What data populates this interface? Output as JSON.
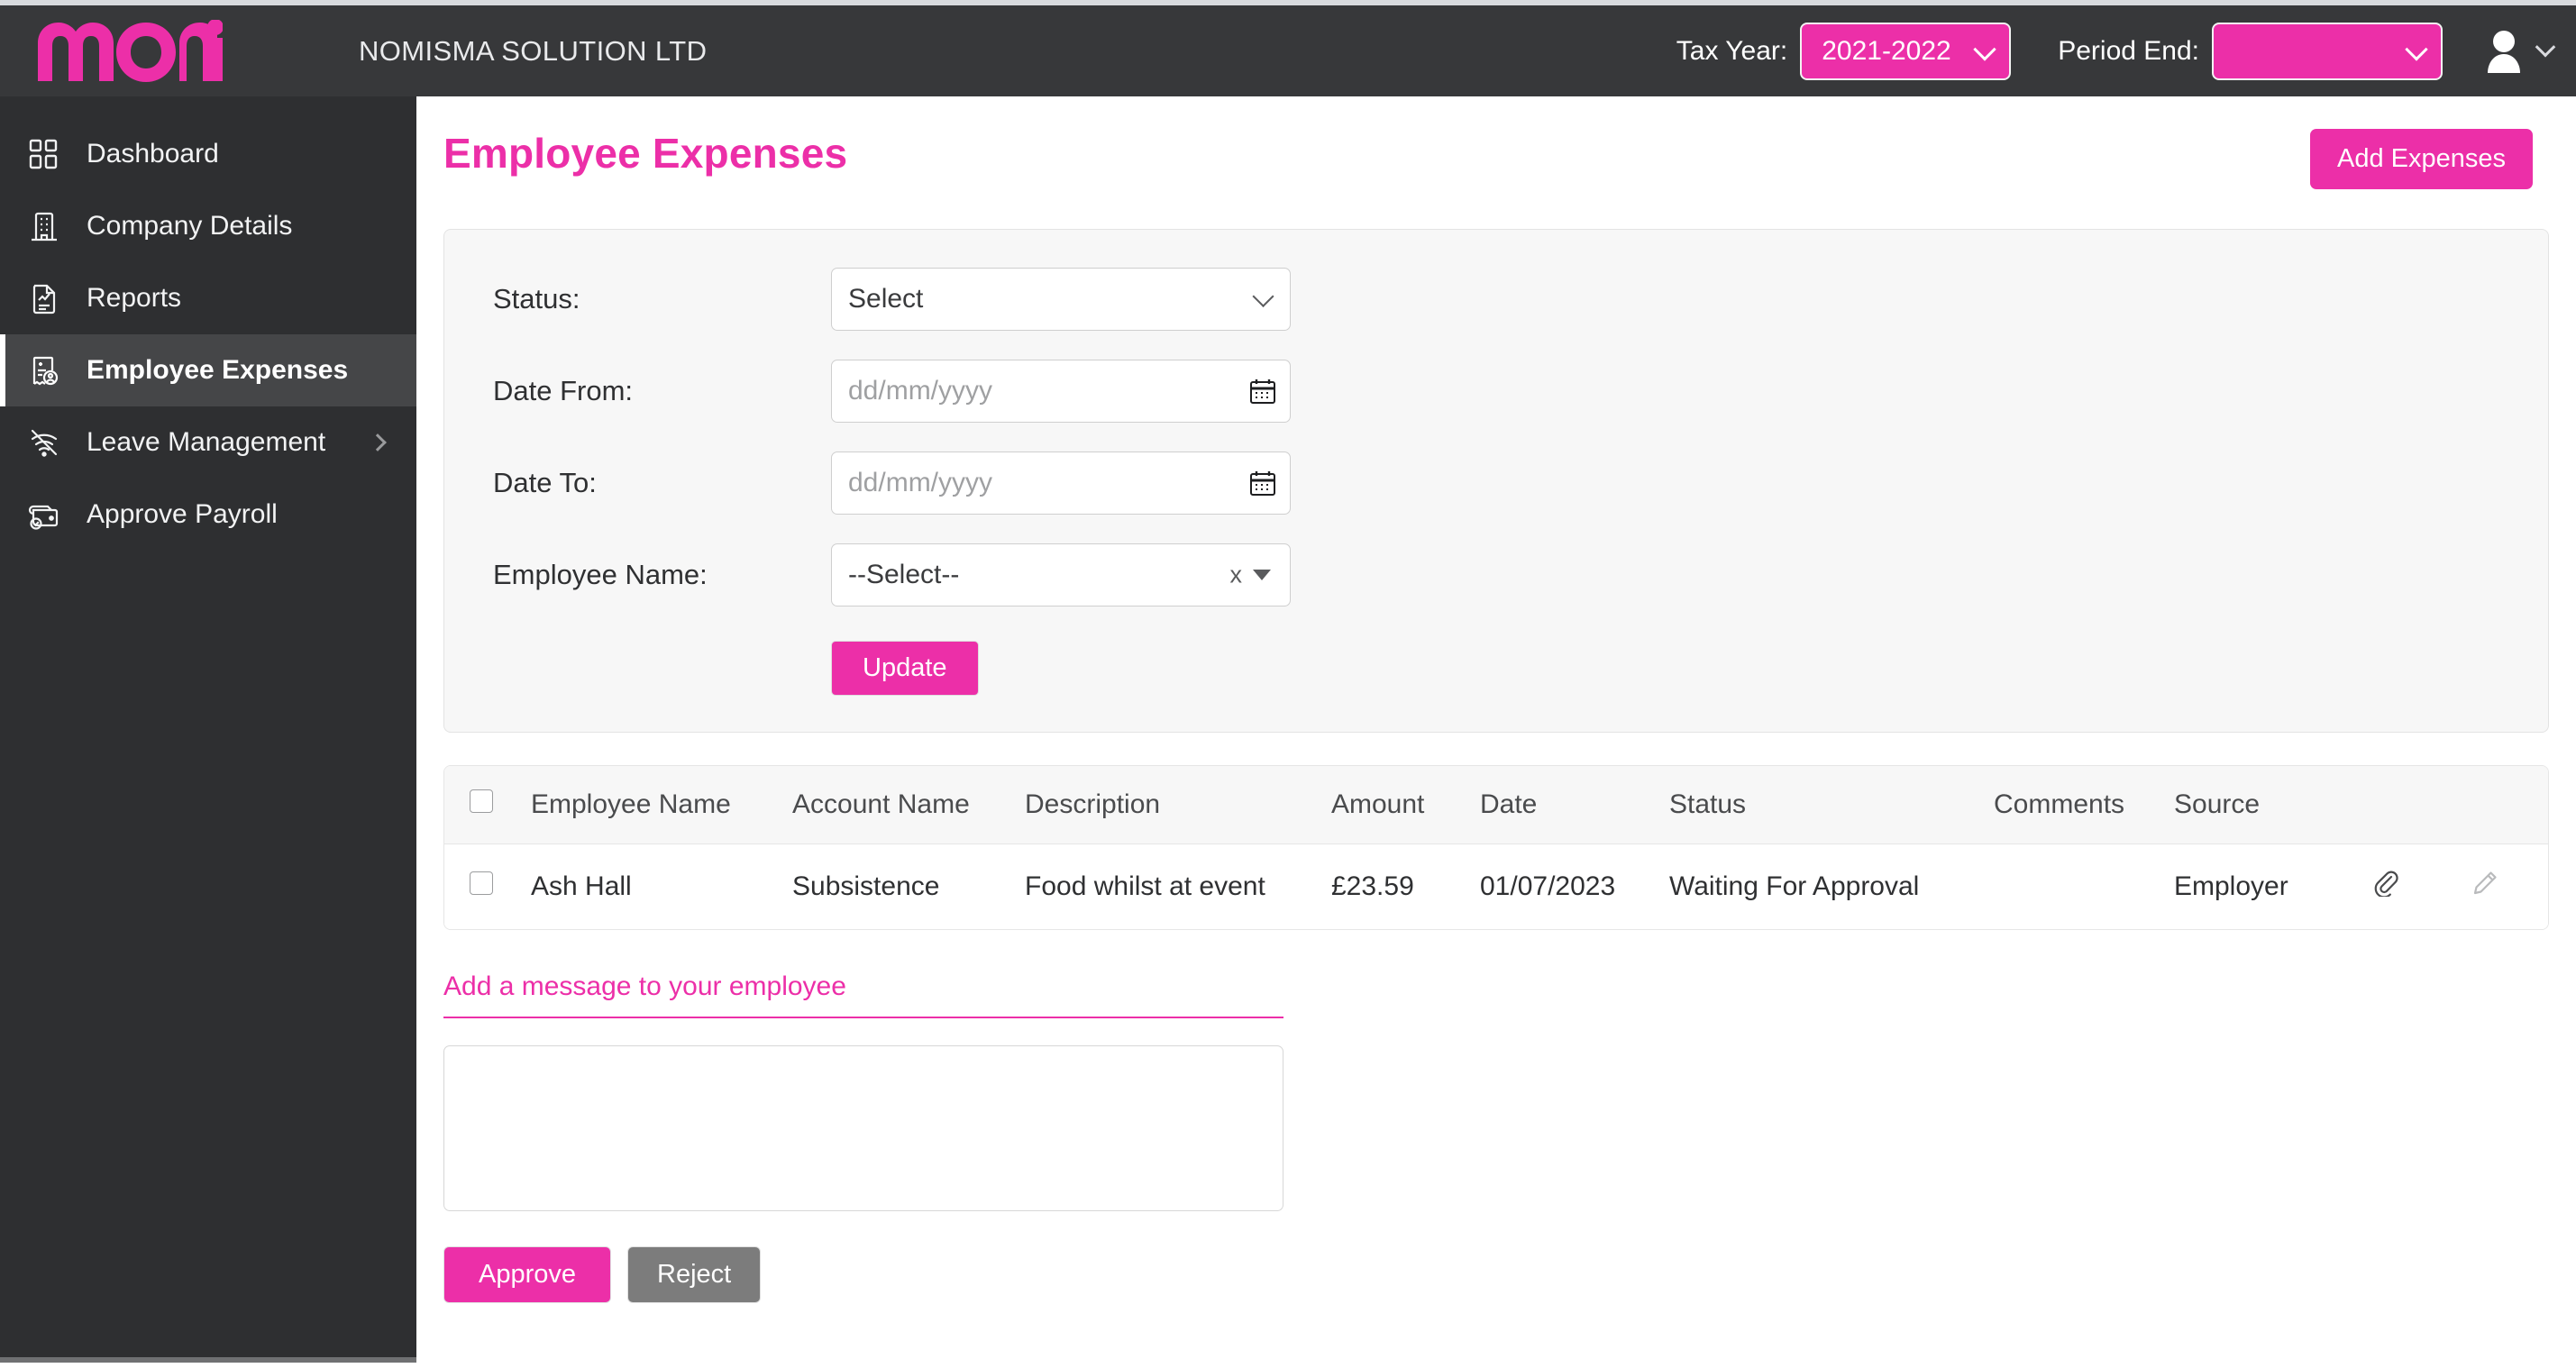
{
  "header": {
    "logo_text": "nomi",
    "company_name": "NOMISMA SOLUTION LTD",
    "tax_year_label": "Tax Year:",
    "tax_year_value": "2021-2022",
    "period_end_label": "Period End:",
    "period_end_value": "",
    "accent_color": "#ec2fa8",
    "bar_color": "#37383a"
  },
  "sidebar": {
    "items": [
      {
        "label": "Dashboard",
        "icon": "dashboard-grid-icon",
        "active": false,
        "expandable": false
      },
      {
        "label": "Company Details",
        "icon": "building-icon",
        "active": false,
        "expandable": false
      },
      {
        "label": "Reports",
        "icon": "report-document-icon",
        "active": false,
        "expandable": false
      },
      {
        "label": "Employee Expenses",
        "icon": "expense-receipt-icon",
        "active": true,
        "expandable": false
      },
      {
        "label": "Leave Management",
        "icon": "leave-signal-icon",
        "active": false,
        "expandable": true
      },
      {
        "label": "Approve Payroll",
        "icon": "payroll-wallet-icon",
        "active": false,
        "expandable": false
      }
    ]
  },
  "main": {
    "page_title": "Employee Expenses",
    "add_expenses_label": "Add Expenses"
  },
  "filters": {
    "status": {
      "label": "Status:",
      "value": "Select"
    },
    "date_from": {
      "label": "Date From:",
      "value": "",
      "placeholder": "dd/mm/yyyy"
    },
    "date_to": {
      "label": "Date To:",
      "value": "",
      "placeholder": "dd/mm/yyyy"
    },
    "employee_name": {
      "label": "Employee Name:",
      "value": "--Select--",
      "clear_glyph": "x"
    },
    "update_label": "Update"
  },
  "table": {
    "columns": [
      "Employee Name",
      "Account Name",
      "Description",
      "Amount",
      "Date",
      "Status",
      "Comments",
      "Source"
    ],
    "rows": [
      {
        "selected": false,
        "employee_name": "Ash Hall",
        "account_name": "Subsistence",
        "description": "Food whilst at event",
        "amount": "£23.59",
        "date": "01/07/2023",
        "status": "Waiting For Approval",
        "comments": "",
        "source": "Employer"
      }
    ]
  },
  "message": {
    "title": "Add a message to your employee",
    "textarea_value": "",
    "approve_label": "Approve",
    "reject_label": "Reject"
  }
}
